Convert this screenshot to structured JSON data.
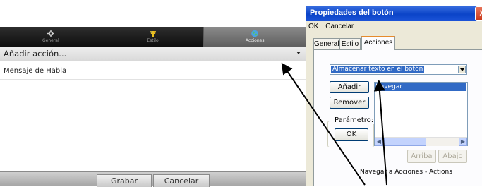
{
  "new_ui": {
    "tabs": [
      {
        "label": "General",
        "icon": "gear-icon"
      },
      {
        "label": "Estilo",
        "icon": "paint-icon"
      },
      {
        "label": "Acciones",
        "icon": "globe-icon"
      }
    ],
    "active_tab": "Acciones",
    "action_dropdown": {
      "value": "Añadir acción..."
    },
    "actions": [
      "Mensaje de Habla"
    ],
    "bottom_buttons": {
      "save": "Grabar",
      "cancel": "Cancelar"
    }
  },
  "old_dialog": {
    "title": "Propiedades del botón",
    "menu": [
      "OK",
      "Cancelar"
    ],
    "tabs": [
      "General",
      "Estilo",
      "Acciones"
    ],
    "active_tab": "Acciones",
    "action_select": "Almacenar texto en el botón",
    "add_button": "Añadir",
    "remove_button": "Remover",
    "parameter_label": "Parámetro:",
    "ok_button": "OK",
    "actions_list": [
      "Navegar"
    ],
    "up_button": "Arriba",
    "down_button": "Abajo",
    "status_text": "Navegar a Acciones - Actions"
  },
  "colors": {
    "titlebar": "#0b44c8",
    "selection": "#316ac5",
    "dialog_bg": "#ece9d8",
    "active_tab": "#7a7a7a"
  }
}
